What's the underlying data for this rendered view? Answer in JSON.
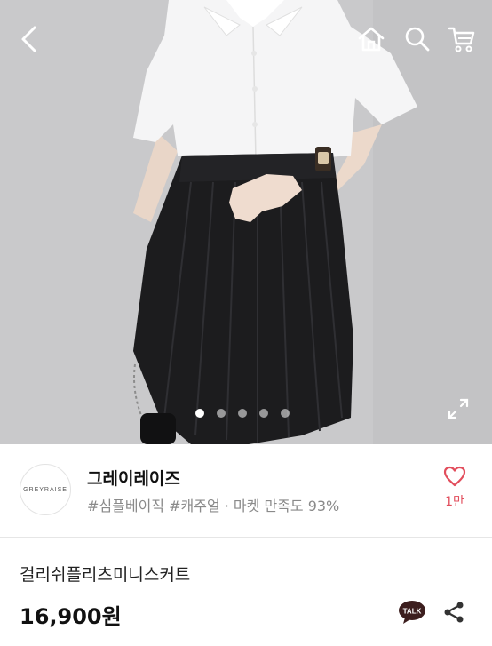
{
  "header": {
    "back_icon": "chevron-left-icon",
    "home_icon": "home-icon",
    "search_icon": "search-icon",
    "cart_icon": "cart-icon"
  },
  "gallery": {
    "dot_count": 5,
    "active_index": 0,
    "expand_icon": "expand-icon"
  },
  "seller": {
    "logo_text": "GREYRAISE",
    "name": "그레이레이즈",
    "tags": "#심플베이직 #캐주얼 · 마켓 만족도 93%",
    "like_count": "1만",
    "like_icon": "heart-icon"
  },
  "product": {
    "name": "걸리쉬플리츠미니스커트",
    "price": "16,900원",
    "talk_label": "TALK",
    "share_icon": "share-icon"
  },
  "colors": {
    "accent": "#e24d5c",
    "text": "#111111",
    "muted": "#8a8a8a"
  }
}
